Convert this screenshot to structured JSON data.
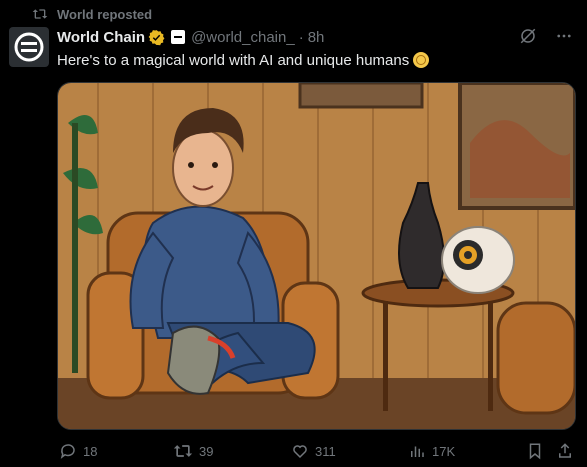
{
  "repost": {
    "label": "World reposted",
    "icon": "repost-icon"
  },
  "author": {
    "name": "World Chain",
    "handle": "@world_chain_",
    "separator": "·",
    "time": "8h",
    "verified_color": "#e8b923",
    "avatar_icon": "world-chain-logo-icon"
  },
  "tweet": {
    "text": "Here's to a magical world with AI and unique humans",
    "emoji_icon": "smiling-emoji-icon"
  },
  "media": {
    "alt_icon": "illustration-man-in-armchair-with-orb-device"
  },
  "actions": {
    "replies": "18",
    "reposts": "39",
    "likes": "311",
    "views": "17K"
  },
  "colors": {
    "background": "#000000",
    "text": "#e7e9ea",
    "muted": "#71767b"
  }
}
